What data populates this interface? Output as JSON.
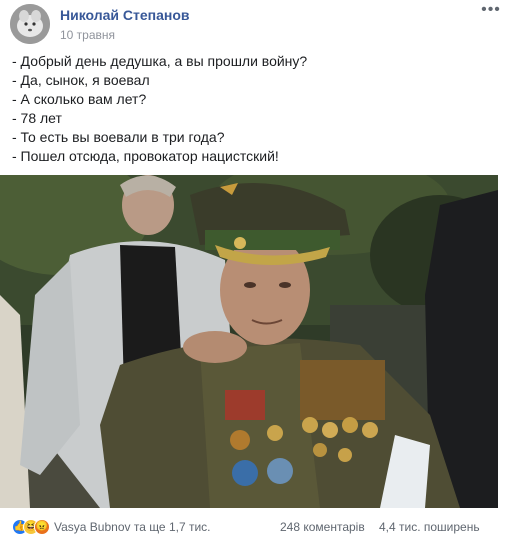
{
  "post": {
    "author": "Николай Степанов",
    "date": "10 травня",
    "text_lines": [
      "- Добрый день дедушка, а вы прошли войну?",
      "- Да, сынок, я воевал",
      "- А сколько вам лет?",
      "- 78 лет",
      "- То есть вы воевали в три года?",
      "- Пошел отсюда, провокатор нацистский!"
    ]
  },
  "footer": {
    "reactions_text": "Vasya Bubnov та ще 1,7 тис.",
    "comments": "248 коментарів",
    "shares": "4,4 тис. поширень"
  },
  "icons": {
    "like": "like-reaction-icon",
    "haha": "haha-reaction-icon",
    "angry": "angry-reaction-icon",
    "more": "more-options-icon"
  },
  "colors": {
    "author_link": "#385898",
    "meta_gray": "#90949c",
    "footer_gray": "#606770",
    "like_blue": "#2078f4"
  }
}
